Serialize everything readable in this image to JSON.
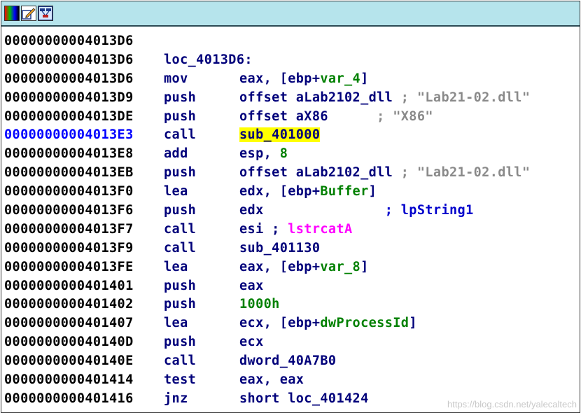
{
  "toolbar": {
    "icons": [
      "color-palette-icon",
      "edit-graph-icon",
      "graph-overview-icon"
    ]
  },
  "listing": [
    {
      "addr": "00000000004013D6",
      "label": ""
    },
    {
      "addr": "00000000004013D6",
      "label": "loc_4013D6:"
    },
    {
      "addr": "00000000004013D6",
      "mnem": "mov",
      "op1": "eax, [ebp+",
      "op1v": "var_4",
      "op1e": "]"
    },
    {
      "addr": "00000000004013D9",
      "mnem": "push",
      "op1": "offset aLab2102_dll",
      "cmt": " ; \"Lab21-02.dll\""
    },
    {
      "addr": "00000000004013DE",
      "mnem": "push",
      "op1": "offset aX86",
      "cmt": "      ; \"X86\""
    },
    {
      "addr": "00000000004013E3",
      "mnem": "call",
      "hl": "sub_401000",
      "current": true
    },
    {
      "addr": "00000000004013E8",
      "mnem": "add",
      "op1": "esp, ",
      "num": "8"
    },
    {
      "addr": "00000000004013EB",
      "mnem": "push",
      "op1": "offset aLab2102_dll",
      "cmt": " ; \"Lab21-02.dll\""
    },
    {
      "addr": "00000000004013F0",
      "mnem": "lea",
      "op1": "edx, [ebp+",
      "op1v": "Buffer",
      "op1e": "]"
    },
    {
      "addr": "00000000004013F6",
      "mnem": "push",
      "op1": "edx",
      "cmt2": "               ; lpString1"
    },
    {
      "addr": "00000000004013F7",
      "mnem": "call",
      "op1": "esi ; ",
      "api": "lstrcatA"
    },
    {
      "addr": "00000000004013F9",
      "mnem": "call",
      "op1": "sub_401130"
    },
    {
      "addr": "00000000004013FE",
      "mnem": "lea",
      "op1": "eax, [ebp+",
      "op1v": "var_8",
      "op1e": "]"
    },
    {
      "addr": "0000000000401401",
      "mnem": "push",
      "op1": "eax"
    },
    {
      "addr": "0000000000401402",
      "mnem": "push",
      "num": "1000h"
    },
    {
      "addr": "0000000000401407",
      "mnem": "lea",
      "op1": "ecx, [ebp+",
      "op1v": "dwProcessId",
      "op1e": "]"
    },
    {
      "addr": "000000000040140D",
      "mnem": "push",
      "op1": "ecx"
    },
    {
      "addr": "000000000040140E",
      "mnem": "call",
      "op1": "dword_40A7B0"
    },
    {
      "addr": "0000000000401414",
      "mnem": "test",
      "op1": "eax, eax"
    },
    {
      "addr": "0000000000401416",
      "mnem": "jnz",
      "op1": "short loc_401424"
    }
  ],
  "watermark": "https://blog.csdn.net/yalecaltech",
  "colors": {
    "titlebar": "#b6e4ec",
    "address": "#000000",
    "current_address": "#0000ff",
    "code": "#00007a",
    "variable": "#008000",
    "api": "#ff00ff",
    "comment": "#8a8a8a",
    "highlight": "#ffff00"
  }
}
